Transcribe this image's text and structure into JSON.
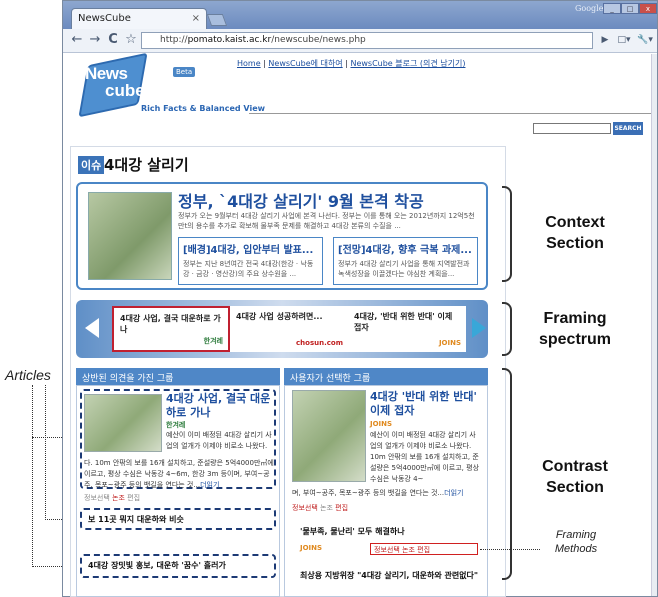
{
  "browser": {
    "tab_title": "NewsCube",
    "tab_close": "×",
    "window_label": "Google",
    "window_controls": [
      "_",
      "□",
      "x"
    ],
    "url_scheme": "http://",
    "url_host": "pomato.kaist.ac.kr",
    "url_path": "/newscube/news.php",
    "nav": {
      "back": "←",
      "forward": "→",
      "reload": "C",
      "star": "☆",
      "play": "▶",
      "page": "□▾",
      "tools": "🔧▾"
    }
  },
  "site": {
    "logo_news": "News",
    "logo_cube": "cube",
    "beta": "Beta",
    "tagline": "Rich Facts & Balanced View",
    "toplinks": [
      "Home",
      "NewsCube에 대하여",
      "NewsCube 블로그 (의견 남기기)"
    ],
    "search_button": "SEARCH"
  },
  "issue": {
    "badge": "이슈",
    "title": "4대강 살리기"
  },
  "context": {
    "headline": "정부, `4대강 살리기' 9월 본격 착공",
    "body": "정부가 오는 9월부터 4대강 살리기 사업에 본격 나선다. 정부는 이를 통해 오는 2012년까지 12억5천만t의 용수를 추가로 확보해 물부족 문제를 해결하고 4대강 본류의 수질을 ...",
    "sub": [
      {
        "head": "[배경]4대강, 입안부터 발표...",
        "body": "정부는 지난 8년여간 전국 4대강(한강 · 낙동강 · 금강 · 영산강)의 주요 상수원을 ..."
      },
      {
        "head": "[전망]4대강, 향후 극복 과제...",
        "body": "정부가 4대강 살리기 사업을 통해 지역발전과 녹색성장을 이끌겠다는 야심찬 계획을..."
      }
    ]
  },
  "framing_cards": [
    {
      "title": "4대강 사업, 결국 대운하로 가나",
      "source": "한겨레"
    },
    {
      "title": "4대강 사업 성공하려면...",
      "source": "chosun.com"
    },
    {
      "title": "4대강, '반대 위한 반대' 이제 접자",
      "source": "JOINS"
    }
  ],
  "left_column": {
    "header": "상반된 의견을 가진 그룹",
    "main": {
      "headline": "4대강 사업, 결국 대운하로 가나",
      "source": "한겨레",
      "body_right": "예산이 이미 배정된 4대강 살리기 사업의 얼개가 이제야 비로소 나왔다.",
      "body_full": "다. 10m 안팎의 보를 16개 설치하고, 준설량은 5억4000만㎥에 이르고, 평상 수심은 낙동강 4~6m, 한강 3m 등이며, 부여~공주, 목포~광주 등의 뱃길을 연다는 것...",
      "more": "더읽기",
      "meta": [
        "정보선택",
        "논조",
        "편집"
      ]
    },
    "articles": [
      "보 11곳 뭐지 대운하와 비슷",
      "4대강 장밋빛 홍보, 대운하 '꿈수' 흘러가"
    ]
  },
  "right_column": {
    "header": "사용자가 선택한 그룹",
    "main": {
      "headline": "4대강 '반대 위한 반대' 이제 접자",
      "source": "JOINS",
      "body_right": "예산이 이미 배정된 4대강 살리기 사업의 얼개가 이제야 비로소 나왔다. 10m 안팎의 보를 16개 설치하고, 준설량은 5억4000만㎥에 이르고, 평상 수심은 낙동강 4~",
      "body_tail": "며, 부여~공주, 목포~광주 등의 뱃길을 연다는 것...",
      "more": "더읽기",
      "meta": [
        "정보선택",
        "논조",
        "편집"
      ]
    },
    "articles": [
      {
        "title": "'물부족, 물난리' 모두 해결하나",
        "source": "JOINS",
        "meta": [
          "정보선택",
          "논조",
          "편집"
        ]
      },
      {
        "title": "최상용 지방위장 \"4대강 살리기, 대운하와 관련없다\"",
        "source": ""
      }
    ]
  },
  "annotations": {
    "context": "Context Section",
    "framing": "Framing spectrum",
    "contrast": "Contrast Section",
    "articles": "Articles",
    "framing_methods": "Framing Methods"
  }
}
